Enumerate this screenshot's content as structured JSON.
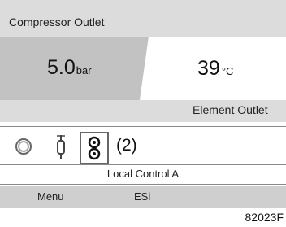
{
  "panel": {
    "title": "Compressor Outlet",
    "left_value": {
      "number": "5.0",
      "unit": "bar"
    },
    "right_value": {
      "number": "39",
      "unit": "°C"
    },
    "element_label": "Element Outlet"
  },
  "icons": {
    "items": [
      {
        "name": "circle-icon",
        "selected": false
      },
      {
        "name": "valve-icon",
        "selected": false
      },
      {
        "name": "local-control-icon",
        "selected": true
      }
    ],
    "annotation": "(2)"
  },
  "status": {
    "mode": "Local Control A"
  },
  "softkeys": {
    "menu": "Menu",
    "esi": "ESi"
  },
  "figure_ref": "82023F",
  "colors": {
    "panel_bg": "#dcdcdc",
    "value_bg": "#c2c2c2",
    "softkey_bg": "#cfcfcf"
  }
}
